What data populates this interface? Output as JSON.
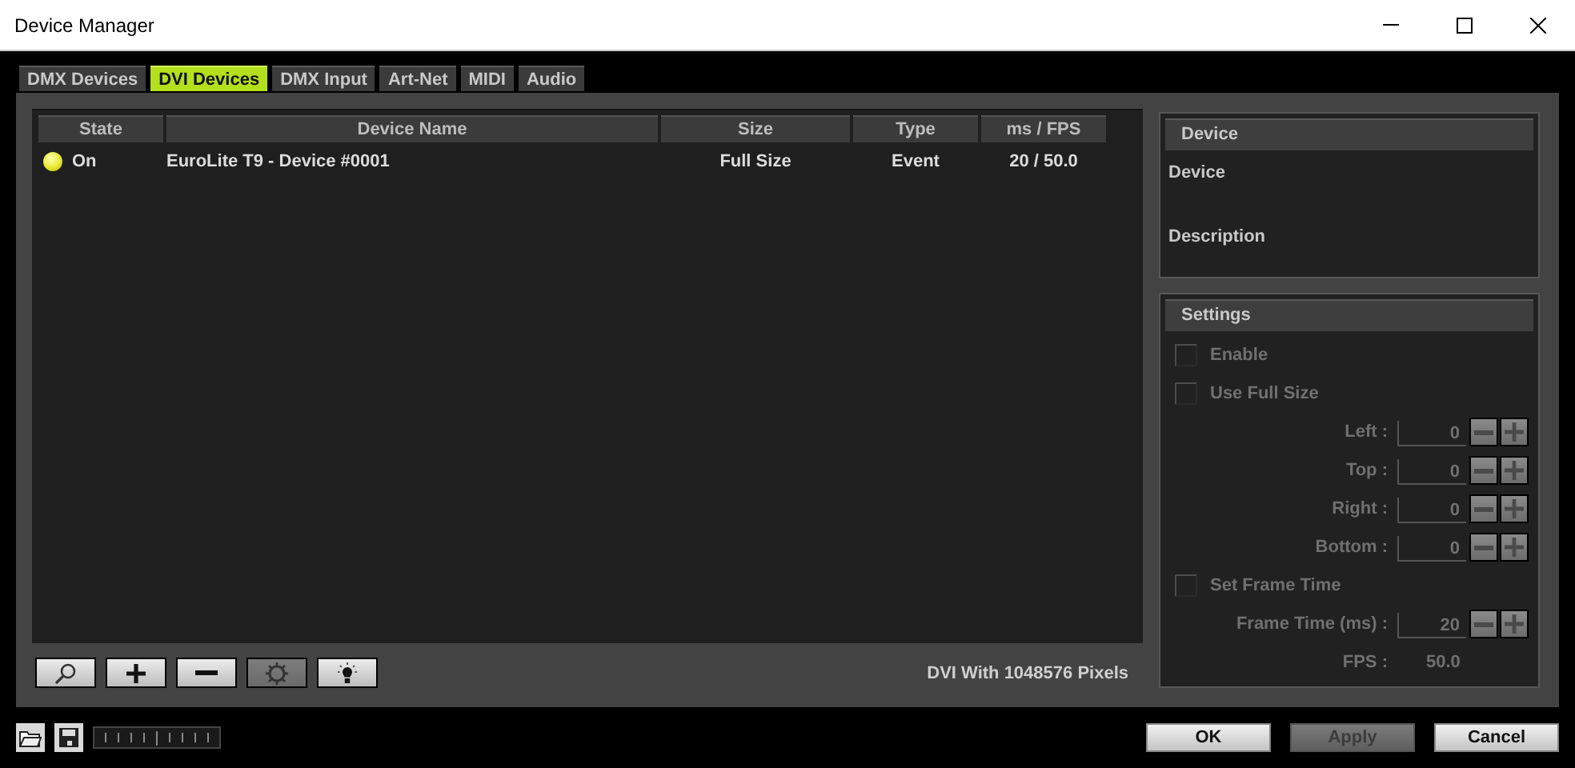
{
  "window": {
    "title": "Device Manager"
  },
  "tabs": [
    {
      "label": "DMX Devices",
      "selected": false
    },
    {
      "label": "DVI Devices",
      "selected": true
    },
    {
      "label": "DMX Input",
      "selected": false
    },
    {
      "label": "Art-Net",
      "selected": false
    },
    {
      "label": "MIDI",
      "selected": false
    },
    {
      "label": "Audio",
      "selected": false
    }
  ],
  "table": {
    "columns": [
      "State",
      "Device Name",
      "Size",
      "Type",
      "ms / FPS"
    ],
    "rows": [
      {
        "state": "On",
        "on": true,
        "device_name": "EuroLite T9 - Device #0001",
        "size": "Full Size",
        "type": "Event",
        "ms_fps": "20 / 50.0"
      }
    ]
  },
  "toolbar": [
    {
      "kind": "search",
      "pressed": false
    },
    {
      "kind": "add",
      "pressed": false
    },
    {
      "kind": "remove",
      "pressed": false
    },
    {
      "kind": "gear",
      "pressed": true
    },
    {
      "kind": "bulb",
      "pressed": false
    }
  ],
  "status": "DVI With 1048576 Pixels",
  "device_panel": {
    "title": "Device",
    "fields": [
      "Device",
      "Description"
    ]
  },
  "settings": {
    "title": "Settings",
    "disabled": true,
    "enable": {
      "label": "Enable",
      "checked": false
    },
    "use_full_size": {
      "label": "Use Full Size",
      "checked": false
    },
    "margins": [
      {
        "label": "Left :",
        "value": "0"
      },
      {
        "label": "Top :",
        "value": "0"
      },
      {
        "label": "Right :",
        "value": "0"
      },
      {
        "label": "Bottom :",
        "value": "0"
      }
    ],
    "set_frame_time": {
      "label": "Set Frame Time",
      "checked": false
    },
    "frame_time": {
      "label": "Frame Time (ms) :",
      "value": "20"
    },
    "fps": {
      "label": "FPS :",
      "value": "50.0"
    }
  },
  "footer": {
    "buttons": [
      {
        "label": "OK",
        "disabled": false
      },
      {
        "label": "Apply",
        "disabled": true
      },
      {
        "label": "Cancel",
        "disabled": false
      }
    ]
  }
}
